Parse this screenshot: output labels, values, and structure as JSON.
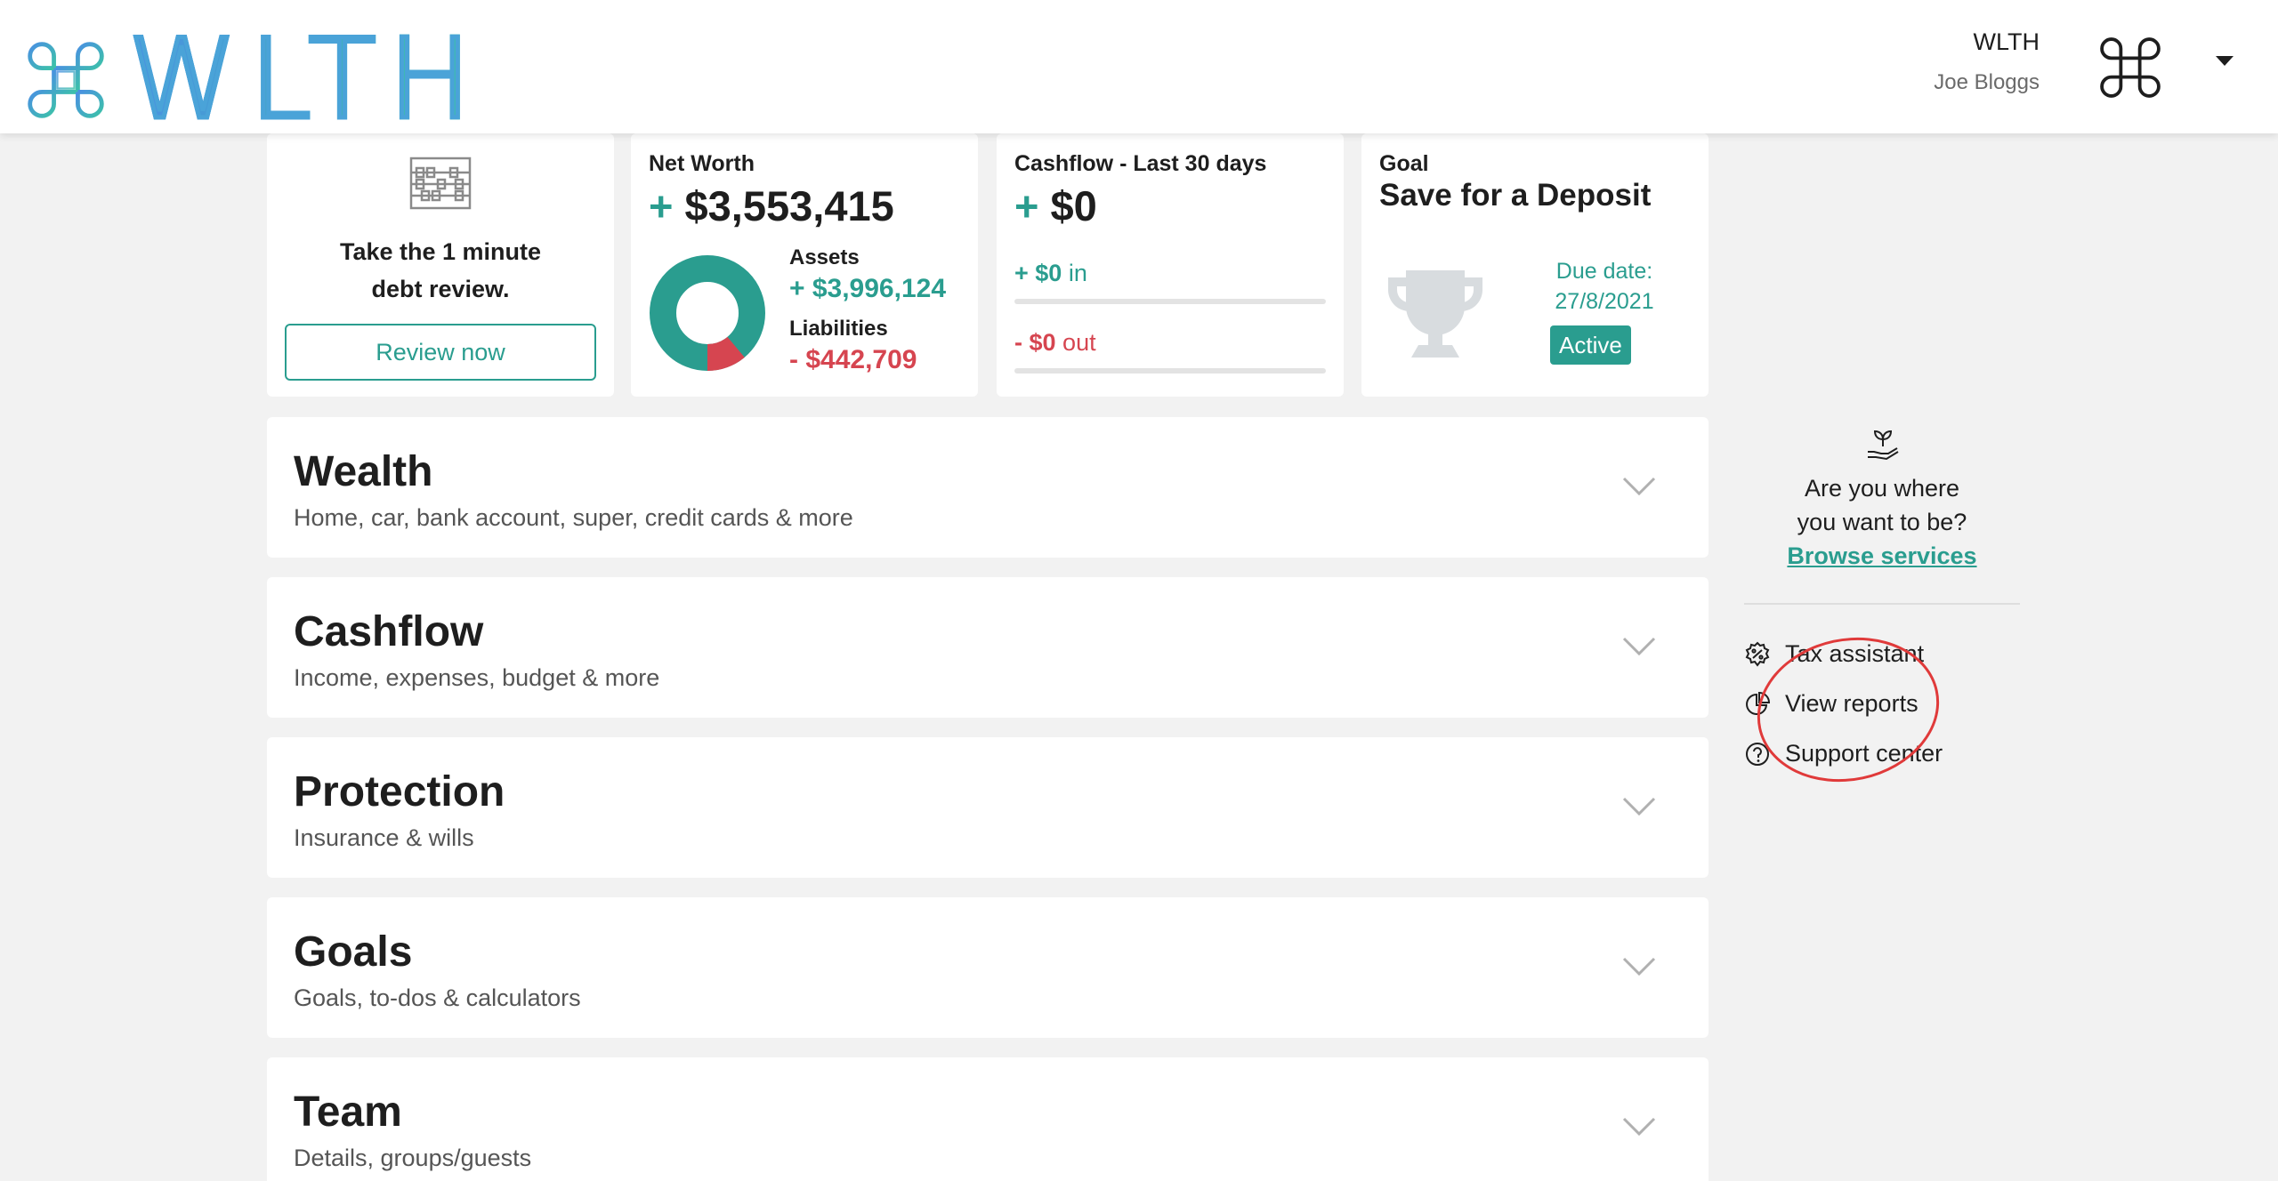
{
  "header": {
    "logo_text": "WLTH",
    "org_name": "WLTH",
    "user_name": "Joe Bloggs",
    "icons": [
      "command-logo-icon",
      "command-avatar-icon",
      "caret-down-icon"
    ]
  },
  "cards": {
    "debt": {
      "line1": "Take the 1 minute",
      "line2": "debt review.",
      "button_label": "Review now",
      "icon": "abacus-icon"
    },
    "networth": {
      "label": "Net Worth",
      "sign": "+",
      "value": "$3,553,415",
      "assets_label": "Assets",
      "assets_value": "+ $3,996,124",
      "liabilities_label": "Liabilities",
      "liabilities_value": "- $442,709",
      "liabilities_fraction": 0.111
    },
    "cashflow": {
      "label": "Cashflow - Last 30 days",
      "sign": "+",
      "value": "$0",
      "in_amount": "+ $0",
      "in_label": "in",
      "out_amount": "- $0",
      "out_label": "out"
    },
    "goal": {
      "label": "Goal",
      "title": "Save for a Deposit",
      "due_label": "Due date:",
      "due_date": "27/8/2021",
      "status": "Active",
      "icon": "trophy-icon"
    }
  },
  "sections": [
    {
      "title": "Wealth",
      "subtitle": "Home, car, bank account, super, credit cards & more"
    },
    {
      "title": "Cashflow",
      "subtitle": "Income, expenses, budget & more"
    },
    {
      "title": "Protection",
      "subtitle": "Insurance & wills"
    },
    {
      "title": "Goals",
      "subtitle": "Goals, to-dos & calculators"
    },
    {
      "title": "Team",
      "subtitle": "Details, groups/guests"
    }
  ],
  "sidebar": {
    "prompt_line1": "Are you where",
    "prompt_line2": "you want to be?",
    "browse_label": "Browse services",
    "items": [
      {
        "label": "Tax assistant",
        "icon": "tax-icon"
      },
      {
        "label": "View reports",
        "icon": "report-icon"
      },
      {
        "label": "Support center",
        "icon": "question-icon"
      }
    ]
  },
  "colors": {
    "accent": "#2a9d8f",
    "negative": "#d64550",
    "background": "#f2f2f2",
    "annotation": "#e03a3a"
  }
}
